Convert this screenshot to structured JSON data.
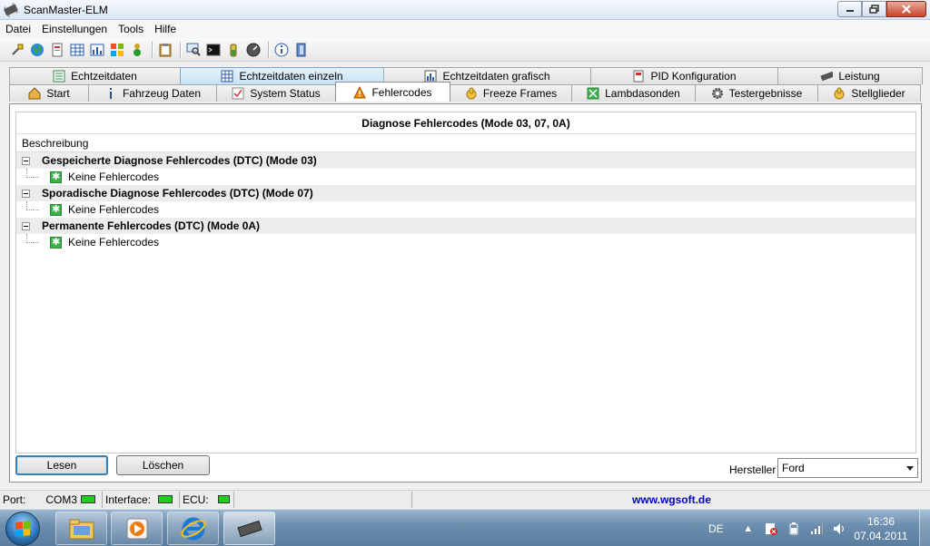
{
  "window": {
    "title": "ScanMaster-ELM",
    "minimize": "0",
    "restore": "❐",
    "close": "✕"
  },
  "menu": [
    "Datei",
    "Einstellungen",
    "Tools",
    "Hilfe"
  ],
  "toolbar": {
    "icons": [
      "connect-plug-icon",
      "globe-icon",
      "document-icon",
      "grid-icon",
      "chart-icon",
      "windows-flag-icon",
      "traffic-light-icon",
      "clipboard-icon",
      "magnifier-icon",
      "terminal-icon",
      "battery-icon",
      "gauge-icon",
      "info-icon",
      "exit-door-icon"
    ]
  },
  "tabs": {
    "row1": [
      {
        "label": "Echtzeitdaten",
        "icon": "list-icon"
      },
      {
        "label": "Echtzeitdaten einzeln",
        "icon": "grid-icon"
      },
      {
        "label": "Echtzeitdaten grafisch",
        "icon": "chart-icon"
      },
      {
        "label": "PID Konfiguration",
        "icon": "pid-doc-icon"
      },
      {
        "label": "Leistung",
        "icon": "chip-icon"
      }
    ],
    "row2": [
      {
        "label": "Start",
        "icon": "home-icon"
      },
      {
        "label": "Fahrzeug Daten",
        "icon": "info-icon"
      },
      {
        "label": "System Status",
        "icon": "checklist-icon"
      },
      {
        "label": "Fehlercodes",
        "icon": "warning-icon"
      },
      {
        "label": "Freeze Frames",
        "icon": "hand-icon"
      },
      {
        "label": "Lambdasonden",
        "icon": "sensor-icon"
      },
      {
        "label": "Testergebnisse",
        "icon": "gear-icon"
      },
      {
        "label": "Stellglieder",
        "icon": "hand-icon"
      }
    ]
  },
  "dtc": {
    "title": "Diagnose Fehlercodes (Mode 03, 07, 0A)",
    "column": "Beschreibung",
    "groups": [
      {
        "label": "Gespeicherte Diagnose Fehlercodes (DTC) (Mode 03)",
        "child": "Keine Fehlercodes"
      },
      {
        "label": "Sporadische Diagnose Fehlercodes (DTC) (Mode 07)",
        "child": "Keine Fehlercodes"
      },
      {
        "label": "Permanente Fehlercodes (DTC) (Mode 0A)",
        "child": "Keine Fehlercodes"
      }
    ]
  },
  "actions": {
    "read": "Lesen",
    "clear": "Löschen"
  },
  "manufacturer": {
    "label": "Hersteller",
    "value": "Ford"
  },
  "status": {
    "port_label": "Port:",
    "port_value": "COM3",
    "interface_label": "Interface:",
    "ecu_label": "ECU:",
    "url": "www.wgsoft.de"
  },
  "taskbar": {
    "lang": "DE",
    "time": "16:36",
    "date": "07.04.2011"
  },
  "colors": {
    "led": "#1ecf1e",
    "ok": "#3fb04a",
    "warning": "#f08a00",
    "link": "#0000cc"
  }
}
